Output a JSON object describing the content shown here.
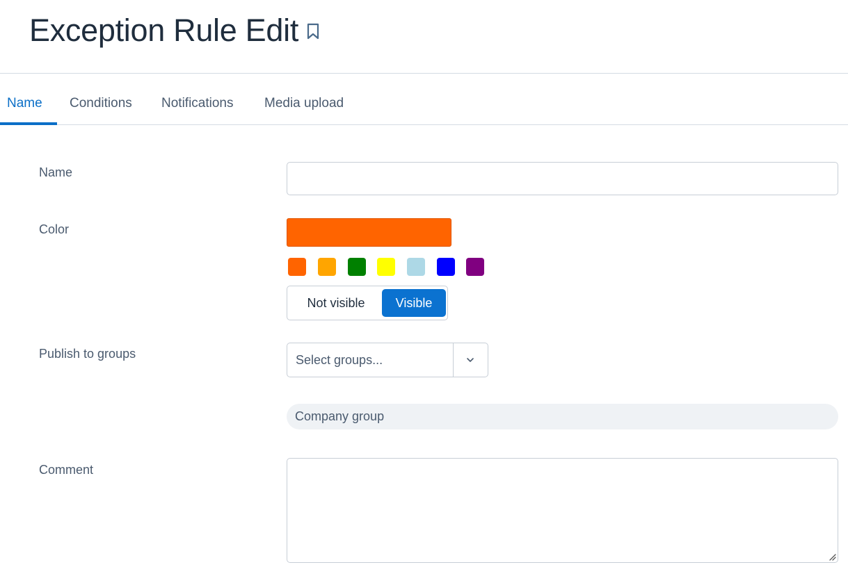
{
  "header": {
    "title": "Exception Rule Edit",
    "bookmark_icon": "bookmark-icon"
  },
  "tabs": [
    {
      "label": "Name",
      "active": true
    },
    {
      "label": "Conditions",
      "active": false
    },
    {
      "label": "Notifications",
      "active": false
    },
    {
      "label": "Media upload",
      "active": false
    }
  ],
  "form": {
    "name": {
      "label": "Name",
      "value": "",
      "placeholder": ""
    },
    "color": {
      "label": "Color",
      "selected": "#ff6400",
      "swatches": [
        "#ff6400",
        "#ffa500",
        "#008000",
        "#ffff00",
        "#add8e6",
        "#0000ff",
        "#800080"
      ],
      "visibility": {
        "options": [
          "Not visible",
          "Visible"
        ],
        "selected": "Visible"
      }
    },
    "publish": {
      "label": "Publish to groups",
      "placeholder": "Select groups...",
      "chevron_icon": "chevron-down-icon",
      "selected_groups": [
        "Company group"
      ]
    },
    "comment": {
      "label": "Comment",
      "value": ""
    }
  },
  "colors": {
    "accent": "#0b72d0",
    "tab_active": "#0b6fc7",
    "text": "#4a5a6e",
    "title": "#1f2d3d",
    "border": "#c7ced6",
    "chip_bg": "#eff2f5"
  }
}
